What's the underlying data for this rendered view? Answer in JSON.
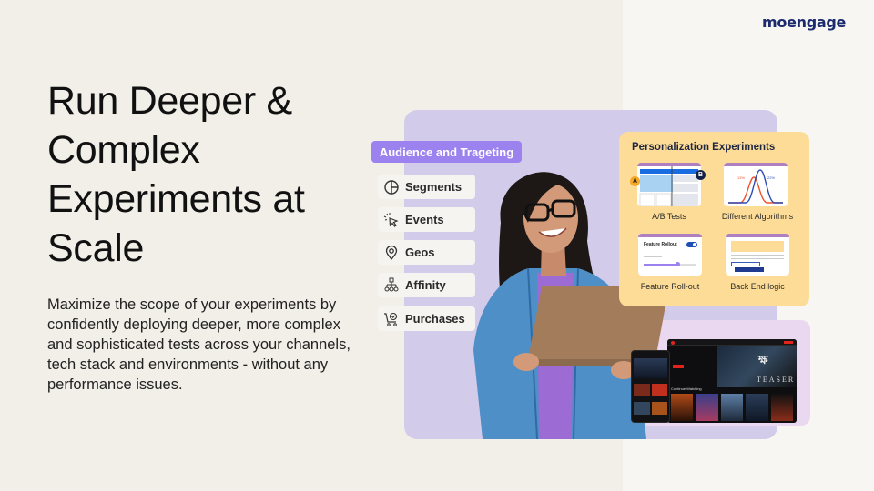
{
  "brand": {
    "logo_text": "moengage"
  },
  "hero": {
    "headline": "Run Deeper & Complex Experiments at Scale",
    "body": "Maximize the scope of your experiments by confidently deploying deeper, more complex and sophisticated tests across your channels, tech stack and environments - without any performance issues."
  },
  "audience": {
    "header": "Audience and Trageting",
    "items": [
      {
        "label": "Segments",
        "icon": "pie-chart-icon"
      },
      {
        "label": "Events",
        "icon": "cursor-click-icon"
      },
      {
        "label": "Geos",
        "icon": "map-pin-icon"
      },
      {
        "label": "Affinity",
        "icon": "hierarchy-icon"
      },
      {
        "label": "Purchases",
        "icon": "shopping-cart-icon"
      }
    ]
  },
  "personalization": {
    "title": "Personalization Experiments",
    "cards": [
      {
        "label": "A/B Tests",
        "badge_a": "A",
        "badge_b": "B"
      },
      {
        "label": "Different Algorithms",
        "value_left": "13%",
        "value_right": "22%"
      },
      {
        "label": "Feature Roll-out",
        "toggle_label": "Feature Rollout",
        "slider_value": 0.65
      },
      {
        "label": "Back End logic"
      }
    ]
  },
  "streaming_preview": {
    "banner_text": "TEASER",
    "section_title": "Continue Watching"
  },
  "colors": {
    "brand_navy": "#1c2a6e",
    "accent_purple": "#9b82ee",
    "panel_purple": "#d2cbea",
    "panel_yellow": "#fddc97",
    "algo_red": "#f0522c",
    "algo_blue": "#2d4db3"
  }
}
